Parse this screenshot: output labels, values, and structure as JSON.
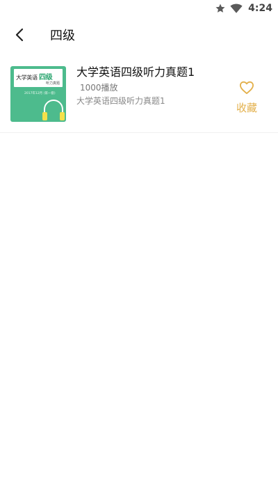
{
  "status_bar": {
    "time": "4:24",
    "icons": [
      "star-icon",
      "wifi-icon"
    ]
  },
  "header": {
    "back_icon": "chevron-left-icon",
    "title": "四级"
  },
  "items": [
    {
      "cover": {
        "title_main": "大学英语",
        "title_accent": "四级",
        "subtitle": "听力真题",
        "date": "2017年12月 (第一套)",
        "colors": {
          "background": "#4dbb8d",
          "accent": "#2aa56f",
          "headphones": "#f3e04a"
        }
      },
      "title": "大学英语四级听力真题1",
      "plays": "1000播放",
      "description": "大学英语四级听力真题1",
      "favorite": {
        "icon": "heart-outline-icon",
        "label": "收藏",
        "color": "#e3b04b"
      }
    }
  ]
}
